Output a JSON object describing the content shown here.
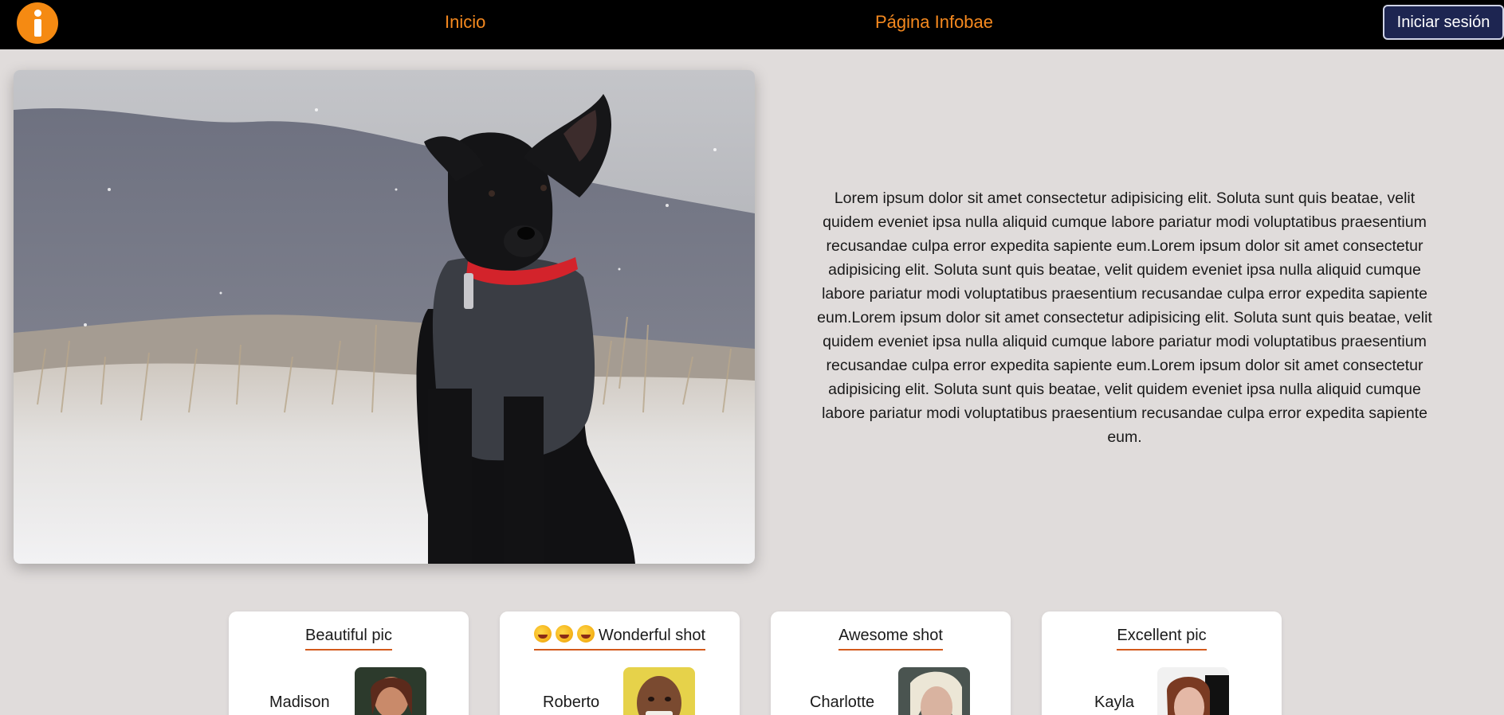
{
  "navbar": {
    "logo_icon": "info-logo-icon",
    "links": [
      {
        "label": "Inicio"
      },
      {
        "label": "Página Infobae"
      }
    ],
    "login_label": "Iniciar sesión",
    "colors": {
      "background": "#000000",
      "link": "#f5891f",
      "logo": "#f58a12",
      "login_button": "#1d2551"
    }
  },
  "hero": {
    "image": "black dog wearing a grey sweater and red collar sitting in snowy grass with misty mountains behind",
    "text": "Lorem ipsum dolor sit amet consectetur adipisicing elit. Soluta sunt quis beatae, velit quidem eveniet ipsa nulla aliquid cumque labore pariatur modi voluptatibus praesentium recusandae culpa error expedita sapiente eum.Lorem ipsum dolor sit amet consectetur adipisicing elit. Soluta sunt quis beatae, velit quidem eveniet ipsa nulla aliquid cumque labore pariatur modi voluptatibus praesentium recusandae culpa error expedita sapiente eum.Lorem ipsum dolor sit amet consectetur adipisicing elit. Soluta sunt quis beatae, velit quidem eveniet ipsa nulla aliquid cumque labore pariatur modi voluptatibus praesentium recusandae culpa error expedita sapiente eum.Lorem ipsum dolor sit amet consectetur adipisicing elit. Soluta sunt quis beatae, velit quidem eveniet ipsa nulla aliquid cumque labore pariatur modi voluptatibus praesentium recusandae culpa error expedita sapiente eum."
  },
  "cards": [
    {
      "title": "Beautiful pic",
      "name": "Madison"
    },
    {
      "title": "Wonderful shot",
      "title_emojis": "rolling-on-floor-laughing-emoji x3",
      "name": "Roberto"
    },
    {
      "title": "Awesome shot",
      "name": "Charlotte"
    },
    {
      "title": "Excellent pic",
      "name": "Kayla"
    }
  ]
}
